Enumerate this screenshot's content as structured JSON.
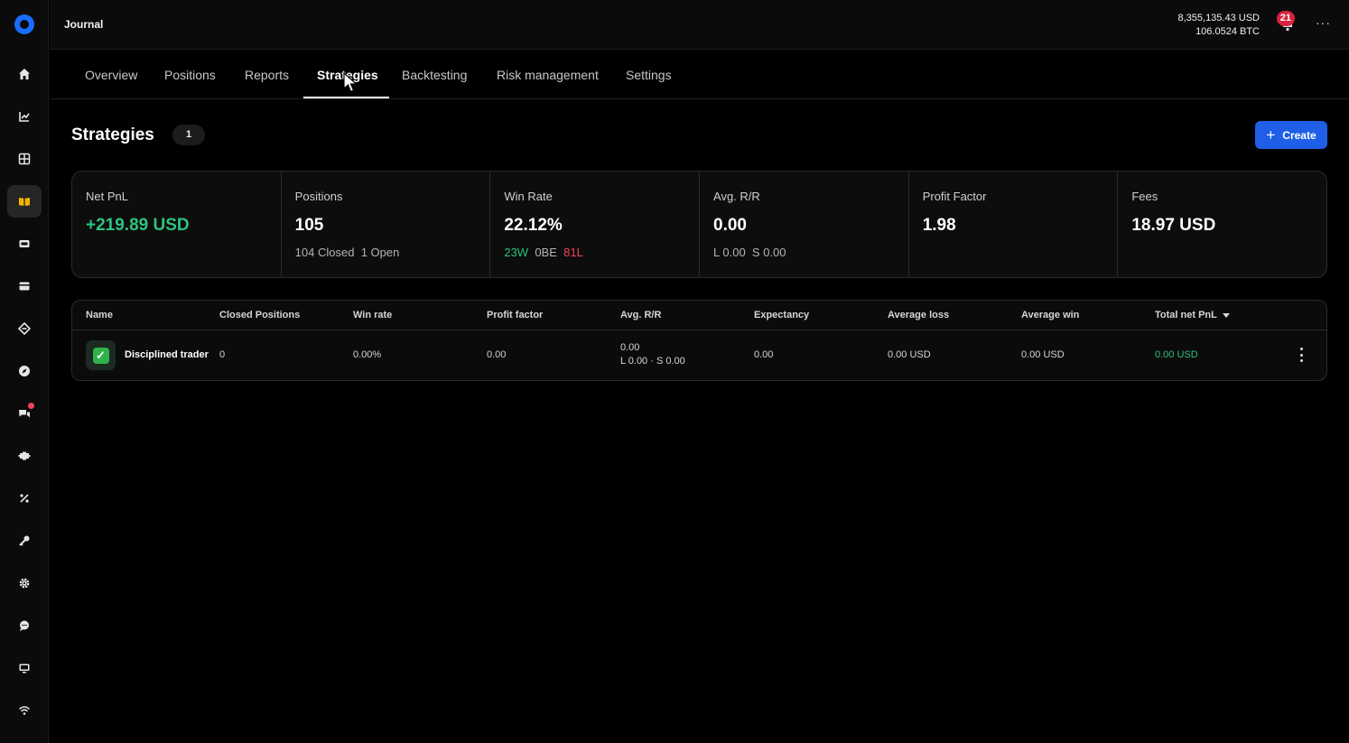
{
  "app": {
    "title": "Journal"
  },
  "balance": {
    "usd": "8,355,135.43 USD",
    "btc": "106.0524 BTC"
  },
  "notifications": {
    "count": "21"
  },
  "more_label": "···",
  "sidebar": {
    "items": [
      {
        "icon": "home-icon"
      },
      {
        "icon": "chart-icon"
      },
      {
        "icon": "grid-icon"
      },
      {
        "icon": "journal-book-icon",
        "active": true
      },
      {
        "icon": "wallet-icon"
      },
      {
        "icon": "card-icon"
      },
      {
        "icon": "tag-icon"
      },
      {
        "icon": "compass-icon"
      },
      {
        "icon": "chat-bubbles-icon",
        "dot": true
      },
      {
        "icon": "puzzle-icon"
      },
      {
        "icon": "percent-icon"
      },
      {
        "icon": "key-icon"
      },
      {
        "icon": "gear-icon"
      },
      {
        "icon": "support-chat-icon"
      },
      {
        "icon": "monitor-icon"
      },
      {
        "icon": "wifi-icon"
      }
    ]
  },
  "tabs": [
    {
      "label": "Overview"
    },
    {
      "label": "Positions"
    },
    {
      "label": "Reports"
    },
    {
      "label": "Strategies",
      "active": true
    },
    {
      "label": "Backtesting"
    },
    {
      "label": "Risk management"
    },
    {
      "label": "Settings"
    }
  ],
  "page": {
    "title": "Strategies",
    "count": "1",
    "create_label": "Create"
  },
  "stats": {
    "net_pnl": {
      "label": "Net PnL",
      "value": "+219.89 USD"
    },
    "positions": {
      "label": "Positions",
      "value": "105",
      "closed": "104 Closed",
      "open": "1 Open"
    },
    "win_rate": {
      "label": "Win Rate",
      "value": "22.12%",
      "wins": "23W",
      "be": "0BE",
      "losses": "81L"
    },
    "avg_rr": {
      "label": "Avg. R/R",
      "value": "0.00",
      "long": "L 0.00",
      "short": "S 0.00"
    },
    "profit_factor": {
      "label": "Profit Factor",
      "value": "1.98"
    },
    "fees": {
      "label": "Fees",
      "value": "18.97 USD"
    }
  },
  "table": {
    "headers": {
      "name": "Name",
      "closed_positions": "Closed Positions",
      "win_rate": "Win rate",
      "profit_factor": "Profit factor",
      "avg_rr": "Avg. R/R",
      "expectancy": "Expectancy",
      "average_loss": "Average loss",
      "average_win": "Average win",
      "total_net_pnl": "Total net PnL"
    },
    "rows": [
      {
        "name": "Disciplined trader",
        "closed_positions": "0",
        "win_rate": "0.00%",
        "profit_factor": "0.00",
        "avg_rr": "0.00",
        "avg_rr_detail": "L 0.00 · S 0.00",
        "expectancy": "0.00",
        "average_loss": "0.00 USD",
        "average_win": "0.00 USD",
        "total_net_pnl": "0.00 USD"
      }
    ]
  },
  "colors": {
    "accent": "#1f5fe8",
    "positive": "#2ec27e",
    "negative": "#f0435a",
    "journal_icon": "#f5b400"
  }
}
